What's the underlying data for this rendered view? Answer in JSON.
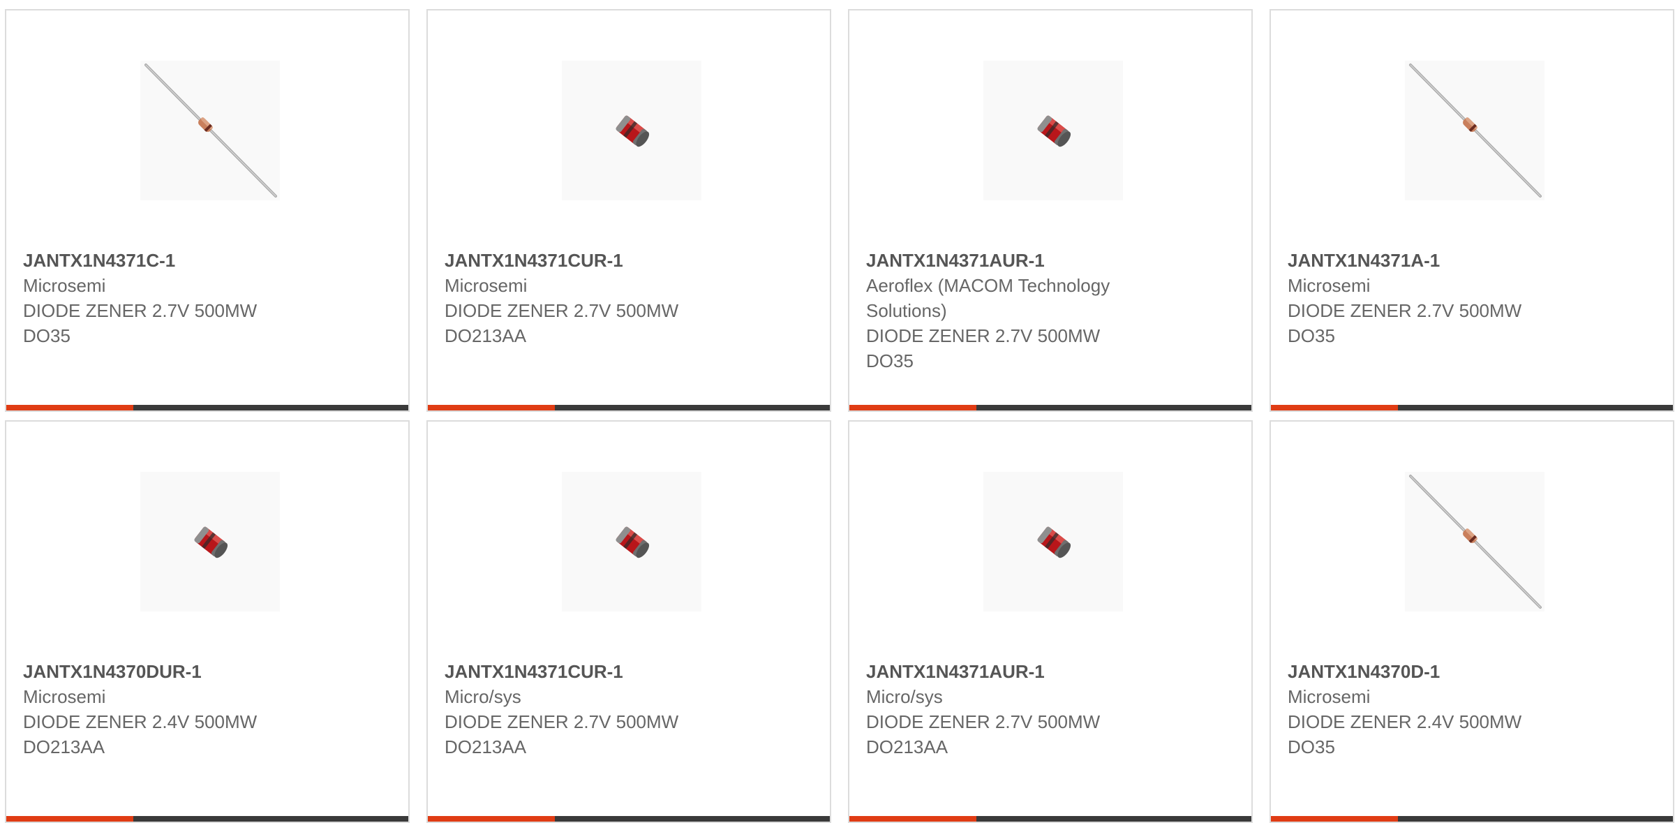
{
  "colors": {
    "accent": "#e03c14",
    "bar": "#3a3a3a",
    "border": "#dcdcdc",
    "text": "#666666"
  },
  "products": [
    {
      "part_number": "JANTX1N4371C-1",
      "manufacturer": "Microsemi",
      "description": "DIODE ZENER 2.7V 500MW",
      "package": "DO35",
      "image_icon": "axial-diode-icon"
    },
    {
      "part_number": "JANTX1N4371CUR-1",
      "manufacturer": "Microsemi",
      "description": "DIODE ZENER 2.7V 500MW",
      "package": "DO213AA",
      "image_icon": "melf-diode-icon"
    },
    {
      "part_number": "JANTX1N4371AUR-1",
      "manufacturer": "Aeroflex (MACOM Technology Solutions)",
      "description": "DIODE ZENER 2.7V 500MW",
      "package": "DO35",
      "image_icon": "melf-diode-icon"
    },
    {
      "part_number": "JANTX1N4371A-1",
      "manufacturer": "Microsemi",
      "description": "DIODE ZENER 2.7V 500MW",
      "package": "DO35",
      "image_icon": "axial-diode-icon"
    },
    {
      "part_number": "JANTX1N4370DUR-1",
      "manufacturer": "Microsemi",
      "description": "DIODE ZENER 2.4V 500MW",
      "package": "DO213AA",
      "image_icon": "melf-diode-icon"
    },
    {
      "part_number": "JANTX1N4371CUR-1",
      "manufacturer": "Micro/sys",
      "description": "DIODE ZENER 2.7V 500MW",
      "package": "DO213AA",
      "image_icon": "melf-diode-icon"
    },
    {
      "part_number": "JANTX1N4371AUR-1",
      "manufacturer": "Micro/sys",
      "description": "DIODE ZENER 2.7V 500MW",
      "package": "DO213AA",
      "image_icon": "melf-diode-icon"
    },
    {
      "part_number": "JANTX1N4370D-1",
      "manufacturer": "Microsemi",
      "description": "DIODE ZENER 2.4V 500MW",
      "package": "DO35",
      "image_icon": "axial-diode-icon"
    }
  ]
}
